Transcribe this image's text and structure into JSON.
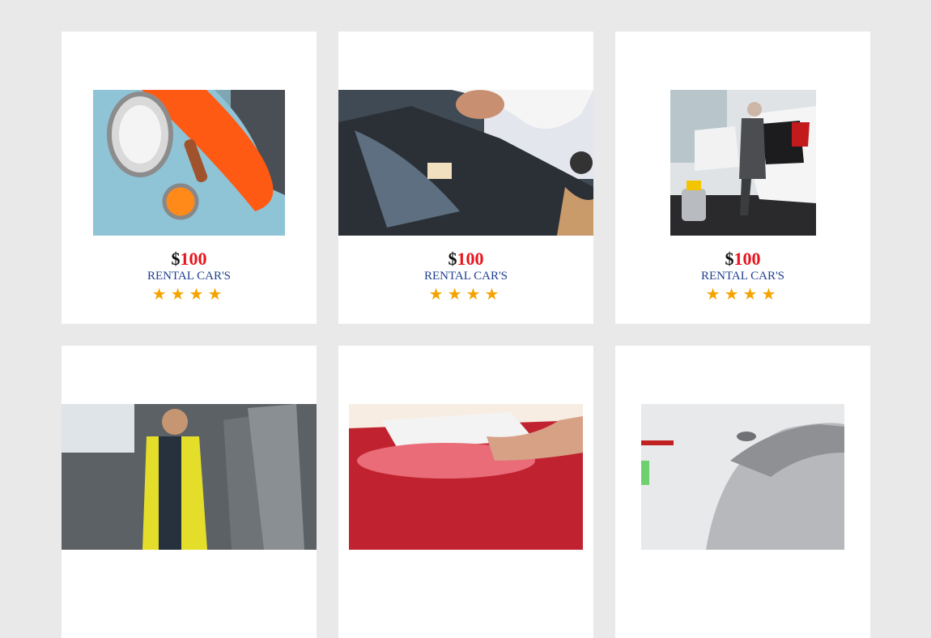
{
  "accent_color": "#e8141b",
  "star_color": "#f5a300",
  "cards": [
    {
      "currency": "$",
      "amount": "100",
      "label": "RENTAL CAR'S",
      "rating": 4,
      "image": "classic-car-headlight-photo"
    },
    {
      "currency": "$",
      "amount": "100",
      "label": "RENTAL CAR'S",
      "rating": 4,
      "image": "mechanic-engine-photo"
    },
    {
      "currency": "$",
      "amount": "100",
      "label": "RENTAL CAR'S",
      "rating": 4,
      "image": "car-vacuum-cleaning-photo"
    },
    {
      "image": "car-interior-technician-photo"
    },
    {
      "image": "car-washing-photo"
    },
    {
      "image": "car-bodywork-photo"
    }
  ]
}
